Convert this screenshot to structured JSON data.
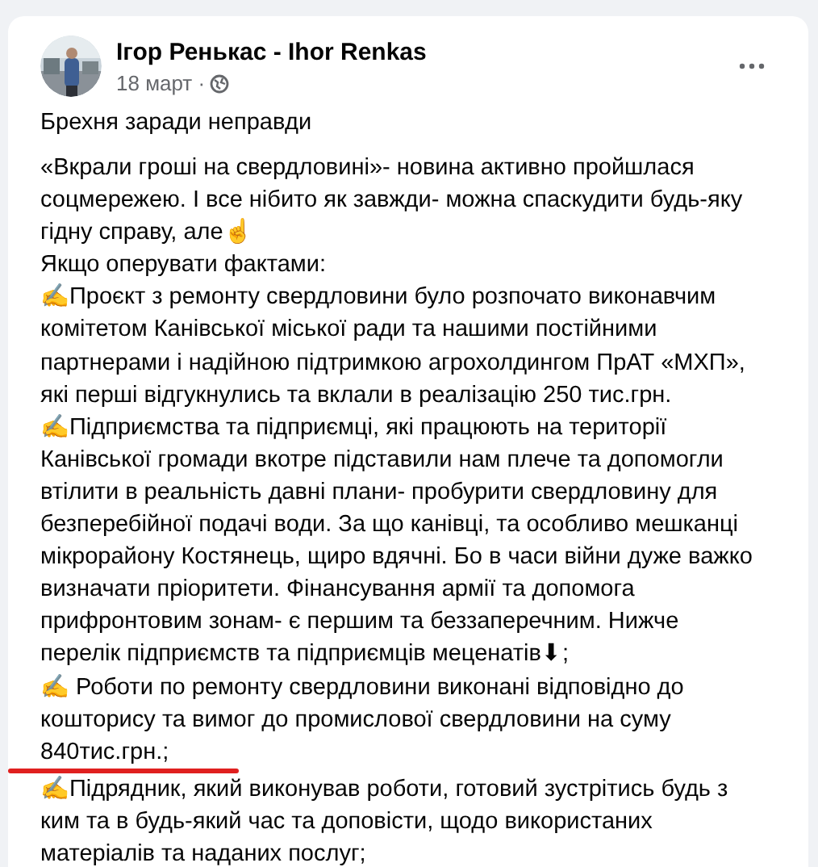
{
  "post": {
    "author": "Ігор Ренькас - Ihor Renkas",
    "date": "18 март ·",
    "avatar": {
      "kind": "picture"
    },
    "title": "Брехня заради неправди",
    "paragraphs": [
      [
        "«Вкрали гроші на свердловині»-  новина активно пройшлася",
        "соцмережею. І все нібито як завжди- можна спаскудити будь-яку",
        "гідну справу, але☝"
      ],
      [
        "Якщо оперувати фактами:"
      ],
      [
        "✍Проєкт з ремонту свердловини було розпочато виконавчим",
        "комітетом Канівської міської ради та нашими постійними",
        "партнерами і надійною підтримкою агрохолдингом ПрАТ «МХП»,",
        "які перші відгукнулись та вклали в реалізацію 250 тис.грн."
      ],
      [
        "✍Підприємства та підприємці, які працюють на території",
        "Канівської громади вкотре підставили нам плече та допомогли",
        "втілити в реальність давні плани- пробурити свердловину для",
        "безперебійної подачі води. За що канівці, та особливо мешканці",
        "мікрорайону Костянець, щиро вдячні. Бо в часи війни дуже важко",
        "визначати пріоритети. Фінансування армії та допомога",
        "прифронтовим зонам- є першим та беззаперечним. Нижче",
        "перелік підприємств та підприємців меценатів⬇;"
      ],
      [
        "✍ Роботи по ремонту свердловини виконані відповідно до",
        "кошторису та вимог до промислової свердловини на суму",
        "840тис.грн.;"
      ],
      [
        "✍Підрядник, який виконував роботи, готовий зустрітись будь з",
        "ким та в будь-який час та доповісти, щодо використаних",
        "матеріалів та наданих послуг;"
      ]
    ]
  }
}
